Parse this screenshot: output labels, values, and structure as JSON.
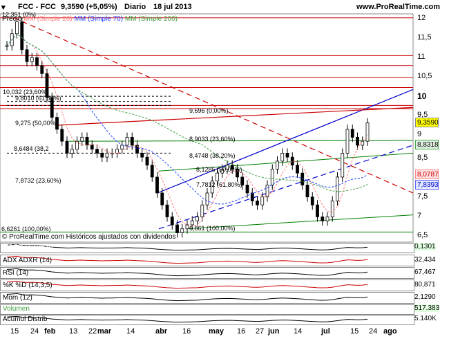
{
  "header": {
    "symbol": "FCC - FCC",
    "last": "9,3590 (+5,05%)",
    "period": "Diario",
    "date": "18 jul 2013",
    "brand": "www.ProRealTime.com"
  },
  "legend": {
    "price": "Precio",
    "ma20": "MM (Simple 20)",
    "ma70": "MM (Simple 70)",
    "ma200": "MM (Simple 200)"
  },
  "footer_note": "© ProRealTime.com Históricos ajustados con dividendos",
  "y_axis": {
    "ticks": [
      "12",
      "11,5",
      "11",
      "10,5",
      "10",
      "9,5",
      "9",
      "8,5",
      "8",
      "7,5",
      "7",
      "6,5"
    ]
  },
  "price_tags": [
    {
      "label": "9,3590",
      "color": "#ffff00"
    },
    {
      "label": "8,8318",
      "color": "#e0f0e0"
    },
    {
      "label": "8,0787",
      "color": "#ffe0e0"
    },
    {
      "label": "7,8393",
      "color": "#e0e8ff"
    }
  ],
  "fibo_labels": [
    {
      "text": "10,032 (23,60%)"
    },
    {
      "text": "9,8010 (61,80%)"
    },
    {
      "text": "9,696 (0,00%)"
    },
    {
      "text": "9,275 (50,00%)"
    },
    {
      "text": "8,9033 (23,60%)"
    },
    {
      "text": "8,6484 (38,2"
    },
    {
      "text": "8,4748 (38,20%)"
    },
    {
      "text": "8,1285 (50,00%)"
    },
    {
      "text": "7,8732 (23,60%)"
    },
    {
      "text": "7,7812 (61,80%)"
    },
    {
      "text": "6,6261 (100,00%)"
    },
    {
      "text": "6,861 (100,00%)"
    },
    {
      "text": "12,351 (0%)"
    }
  ],
  "subpanels": [
    {
      "label": "MACD (12,26,9)",
      "value": "0,1301"
    },
    {
      "label": "ADX  ADXR (14)",
      "value": "32,434"
    },
    {
      "label": "RSI (14)",
      "value": "67,467"
    },
    {
      "label": "%K  %D (14,3,5)",
      "value": "80,871"
    },
    {
      "label": "Mom (12)",
      "value": "2,1290"
    },
    {
      "label": "Volumen",
      "value": "517.383"
    },
    {
      "label": "Acumul Distrib",
      "value": "5.140K"
    }
  ],
  "x_axis": {
    "labels": [
      "15",
      "24",
      "feb",
      "13",
      "22",
      "mar",
      "14",
      "abr",
      "16",
      "may",
      "16",
      "27",
      "jun",
      "14",
      "jul",
      "15",
      "24",
      "ago"
    ]
  },
  "colors": {
    "up": "#000000",
    "ma20": "#ff8080",
    "ma70": "#2040ff",
    "ma200": "#40a040",
    "resistance": "#cc0000",
    "trend": "#0000cc",
    "channel": "#008000"
  },
  "chart_data": {
    "type": "candlestick",
    "ylim": [
      6.4,
      12.1
    ],
    "series": [
      {
        "name": "Precio",
        "values": [
          11.3,
          11.6,
          11.9,
          11.2,
          10.9,
          11.0,
          10.8,
          10.6,
          10.0,
          9.5,
          9.2,
          8.9,
          8.6,
          8.7,
          8.9,
          9.0,
          8.8,
          8.7,
          8.6,
          8.5,
          8.6,
          8.6,
          8.7,
          8.8,
          9.0,
          8.8,
          8.6,
          8.5,
          8.3,
          8.0,
          7.6,
          7.3,
          7.0,
          6.8,
          6.6,
          6.7,
          6.8,
          6.9,
          7.0,
          7.3,
          7.6,
          7.9,
          8.1,
          8.2,
          8.3,
          8.2,
          8.0,
          7.8,
          7.6,
          7.4,
          7.3,
          7.5,
          7.8,
          8.2,
          8.4,
          8.6,
          8.5,
          8.3,
          8.1,
          7.8,
          7.5,
          7.3,
          7.0,
          6.9,
          7.0,
          7.4,
          8.0,
          8.6,
          9.2,
          9.0,
          8.8,
          8.9,
          9.36
        ]
      }
    ]
  }
}
